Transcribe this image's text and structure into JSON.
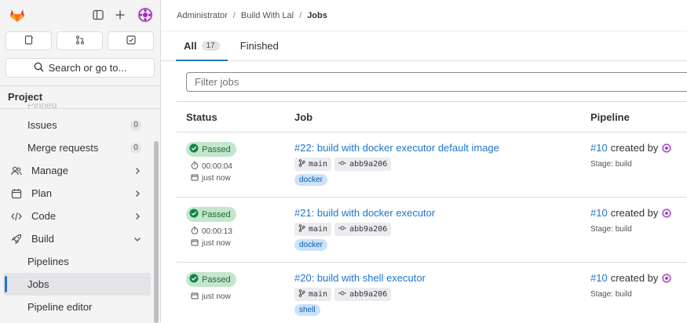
{
  "sidebar": {
    "quick_tabs": [
      {
        "icon": "issues-icon"
      },
      {
        "icon": "merge-request-icon"
      },
      {
        "icon": "todo-icon"
      }
    ],
    "search_label": "Search or go to...",
    "section_title": "Project",
    "ghost_label": "Pinned",
    "items": [
      {
        "label": "Issues",
        "count": "0",
        "sub": true
      },
      {
        "label": "Merge requests",
        "count": "0",
        "sub": true
      },
      {
        "label": "Manage",
        "icon": "users-icon",
        "chevron": "right"
      },
      {
        "label": "Plan",
        "icon": "calendar-icon",
        "chevron": "right"
      },
      {
        "label": "Code",
        "icon": "code-icon",
        "chevron": "right"
      },
      {
        "label": "Build",
        "icon": "rocket-icon",
        "chevron": "down"
      },
      {
        "label": "Pipelines",
        "sub": true
      },
      {
        "label": "Jobs",
        "sub": true,
        "active": true
      },
      {
        "label": "Pipeline editor",
        "sub": true
      }
    ]
  },
  "breadcrumb": [
    "Administrator",
    "Build With Lal",
    "Jobs"
  ],
  "tabs": [
    {
      "label": "All",
      "count": "17",
      "active": true
    },
    {
      "label": "Finished"
    }
  ],
  "filter_placeholder": "Filter jobs",
  "table": {
    "headers": [
      "Status",
      "Job",
      "Pipeline"
    ],
    "rows": [
      {
        "status": "Passed",
        "duration": "00:00:04",
        "finished": "just now",
        "job": "#22: build with docker executor default image",
        "branch": "main",
        "commit": "abb9a206",
        "tag": "docker",
        "pipeline": "#10",
        "created_by": "created by",
        "stage": "Stage: build"
      },
      {
        "status": "Passed",
        "duration": "00:00:13",
        "finished": "just now",
        "job": "#21: build with docker executor",
        "branch": "main",
        "commit": "abb9a206",
        "tag": "docker",
        "pipeline": "#10",
        "created_by": "created by",
        "stage": "Stage: build"
      },
      {
        "status": "Passed",
        "duration": "",
        "finished": "just now",
        "job": "#20: build with shell executor",
        "branch": "main",
        "commit": "abb9a206",
        "tag": "shell",
        "pipeline": "#10",
        "created_by": "created by",
        "stage": "Stage: build"
      }
    ]
  },
  "colors": {
    "accent": "#1f75cb",
    "passed_bg": "#c3e6cd",
    "passed_fg": "#24663b",
    "logo": "#e24329"
  }
}
